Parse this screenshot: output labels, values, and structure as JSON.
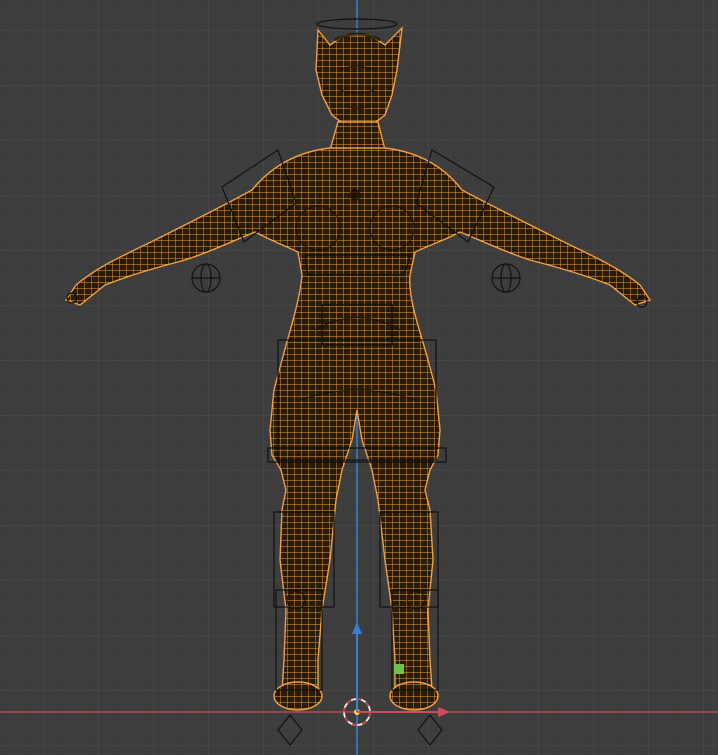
{
  "app": "3D viewport",
  "view": {
    "background_color": "#3d3d3d",
    "grid_minor_color": "#454545",
    "grid_major_color": "#4a4a4a",
    "x_axis_color": "#d14a5c",
    "z_axis_color": "#3a7fd6",
    "wire_color": "#f0a040",
    "rig_color": "#111111",
    "grid_visible": true
  },
  "objects": {
    "mesh": "character-mesh-wireframe",
    "armature": "armature-bones",
    "cursor": "3d-cursor-icon",
    "gizmo": "move-gizmo"
  }
}
